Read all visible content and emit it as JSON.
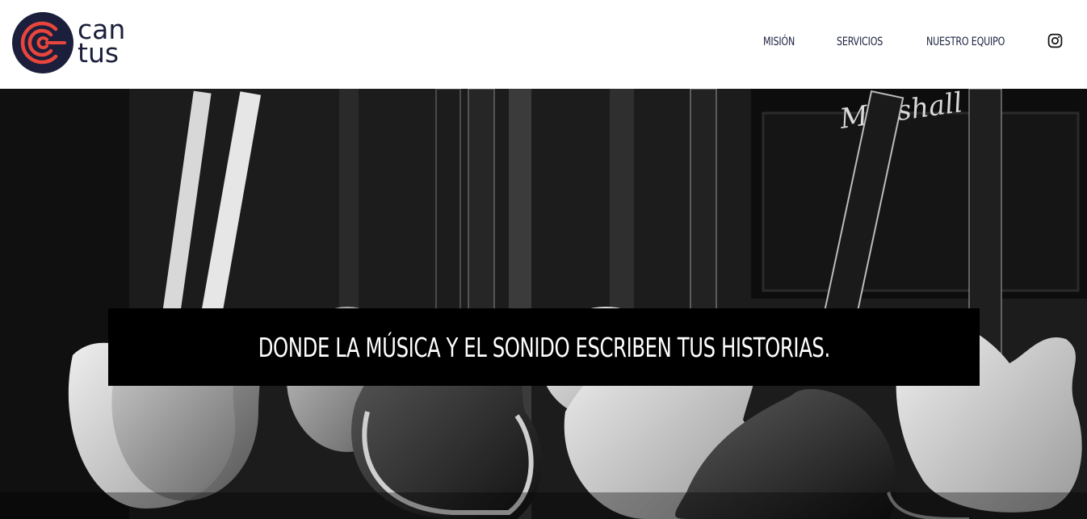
{
  "brand": {
    "logo_line1": "can",
    "logo_line2": "tus",
    "color_dark": "#1b1f3b",
    "color_accent": "#e8453c"
  },
  "nav": {
    "items": [
      {
        "label": "MISIÓN"
      },
      {
        "label": "SERVICIOS"
      },
      {
        "label": "NUESTRO EQUIPO"
      }
    ],
    "social_icon": "instagram-icon"
  },
  "hero": {
    "image_subject": "guitars",
    "amp_brand": "Marshall",
    "tagline": "DONDE LA MÚSICA Y EL SONIDO ESCRIBEN TUS HISTORIAS."
  }
}
